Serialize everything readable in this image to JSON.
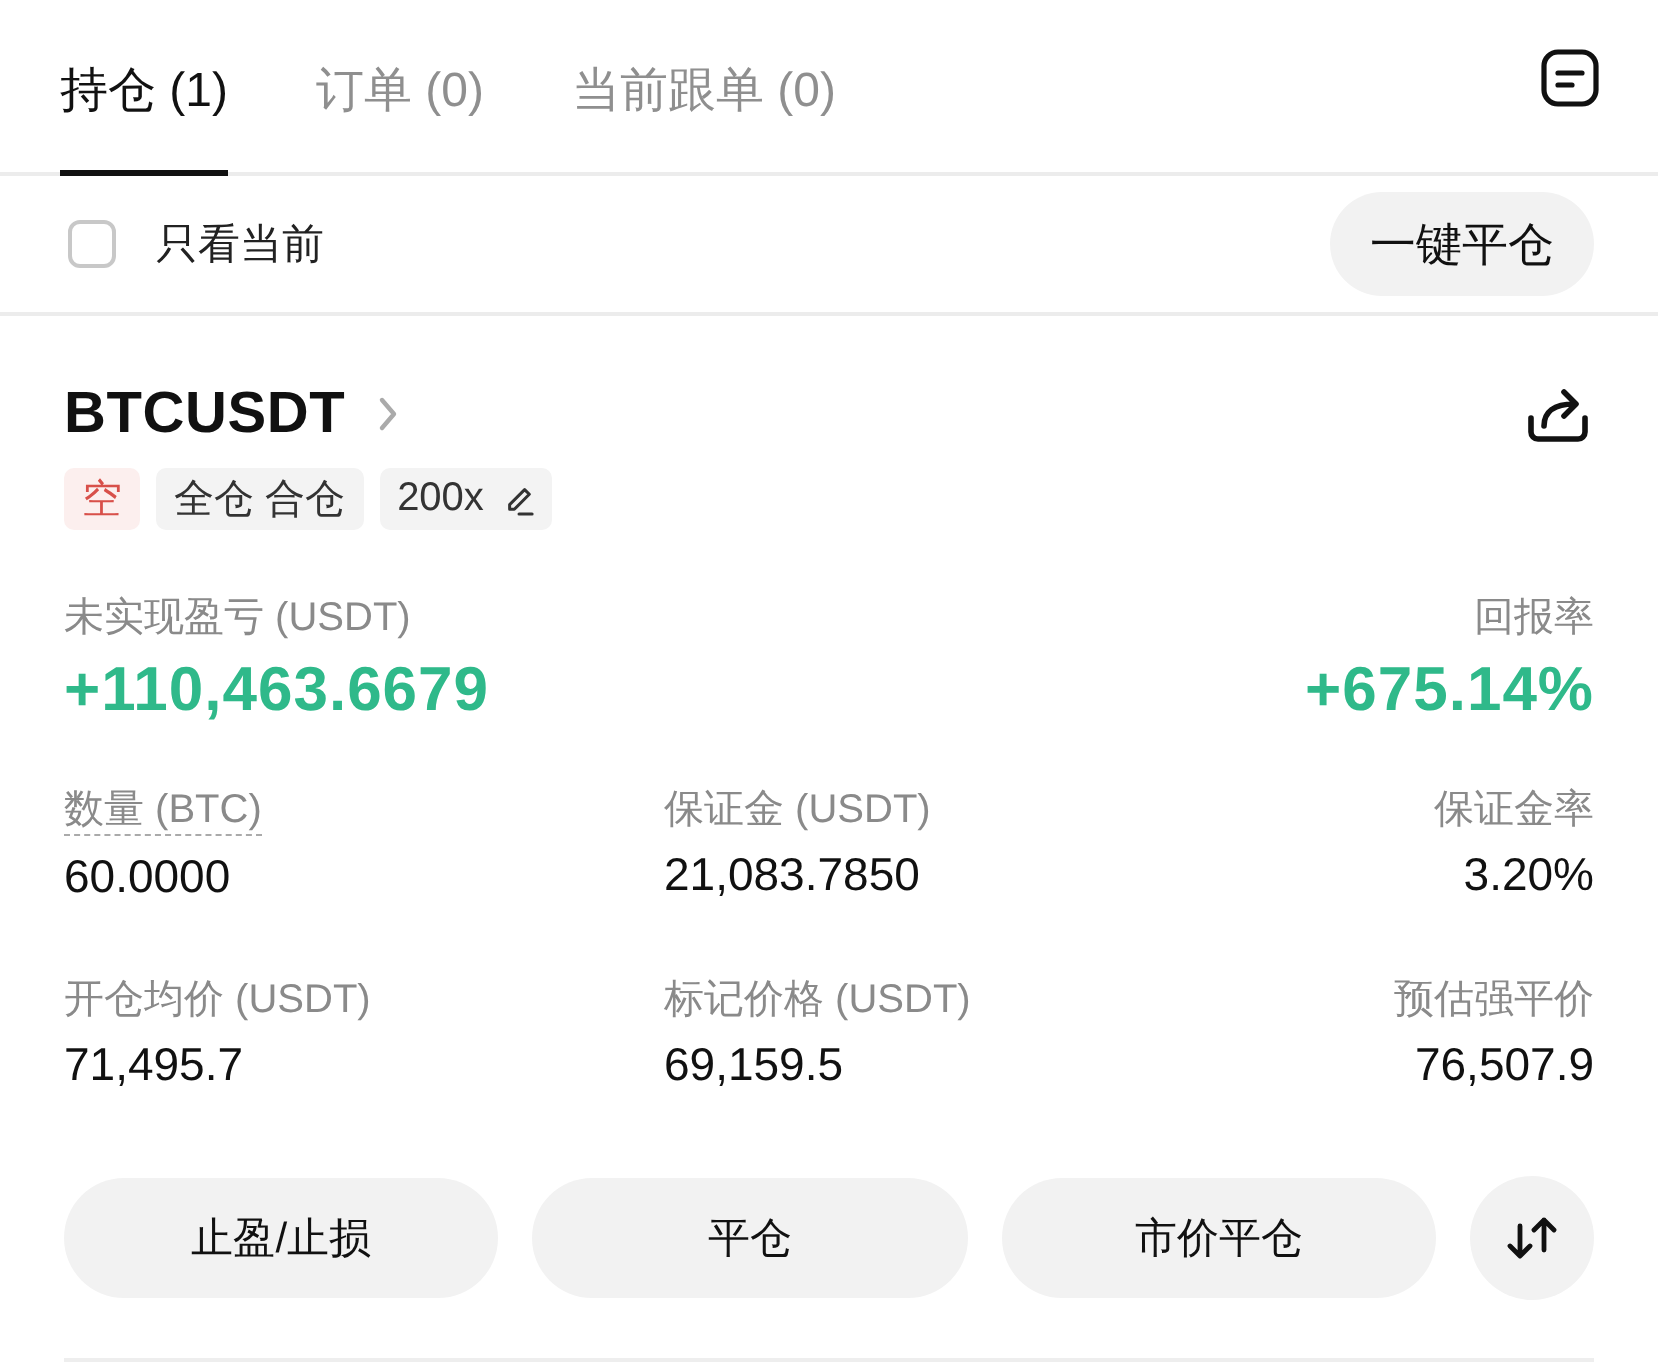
{
  "tabs": [
    {
      "label": "持仓 (1)",
      "selected": true
    },
    {
      "label": "订单 (0)",
      "selected": false
    },
    {
      "label": "当前跟单 (0)",
      "selected": false
    }
  ],
  "filter": {
    "label": "只看当前",
    "checked": false
  },
  "close_all_button": "一键平仓",
  "position": {
    "symbol": "BTCUSDT",
    "tags": [
      {
        "kind": "side",
        "label": "空"
      },
      {
        "kind": "margin",
        "label": "全仓 合仓"
      },
      {
        "kind": "leverage",
        "label": "200x"
      }
    ],
    "pnl": {
      "label": "未实现盈亏 (USDT)",
      "value": "+110,463.6679"
    },
    "roe": {
      "label": "回报率",
      "value": "+675.14%"
    },
    "fields": [
      {
        "label": "数量 (BTC)",
        "value": "60.0000",
        "underlined": true
      },
      {
        "label": "保证金 (USDT)",
        "value": "21,083.7850",
        "underlined": false
      },
      {
        "label": "保证金率",
        "value": "3.20%",
        "underlined": false
      },
      {
        "label": "开仓均价 (USDT)",
        "value": "71,495.7",
        "underlined": false
      },
      {
        "label": "标记价格 (USDT)",
        "value": "69,159.5",
        "underlined": false
      },
      {
        "label": "预估强平价",
        "value": "76,507.9",
        "underlined": false
      }
    ],
    "actions": [
      "止盈/止损",
      "平仓",
      "市价平仓"
    ]
  }
}
